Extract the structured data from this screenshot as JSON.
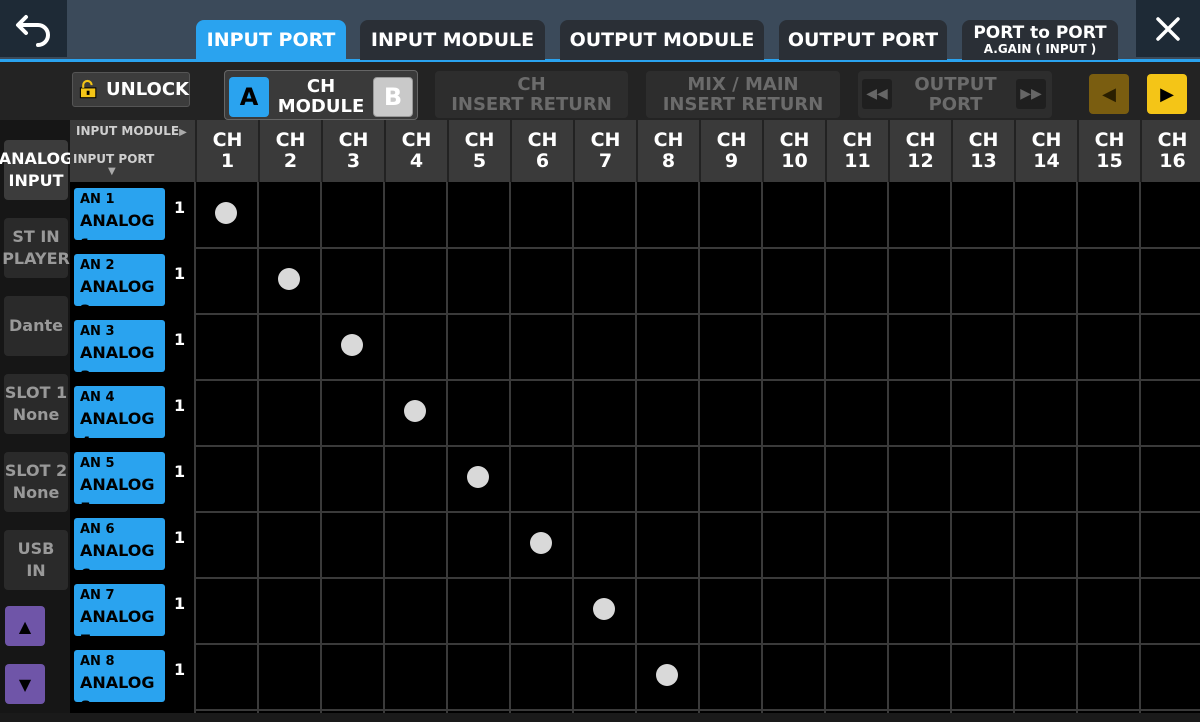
{
  "tabs": [
    {
      "label": "INPUT PORT",
      "active": true
    },
    {
      "label": "INPUT MODULE",
      "active": false
    },
    {
      "label": "OUTPUT MODULE",
      "active": false
    },
    {
      "label": "OUTPUT PORT",
      "active": false
    },
    {
      "label": "PORT to PORT",
      "sublabel": "A.GAIN ( INPUT )",
      "active": false
    }
  ],
  "toolbar": {
    "unlock_label": "UNLOCK",
    "ch_module": {
      "a": "A",
      "label_line1": "CH",
      "label_line2": "MODULE",
      "b": "B"
    },
    "ch_insert_return": {
      "line1": "CH",
      "line2": "INSERT RETURN"
    },
    "mix_main_insert_return": {
      "line1": "MIX / MAIN",
      "line2": "INSERT RETURN"
    },
    "output_port": {
      "line1": "OUTPUT",
      "line2": "PORT"
    }
  },
  "categories": [
    {
      "line1": "ANALOG",
      "line2": "INPUT",
      "active": true
    },
    {
      "line1": "ST IN",
      "line2": "PLAYER",
      "active": false
    },
    {
      "line1": "Dante",
      "line2": "",
      "active": false
    },
    {
      "line1": "SLOT 1",
      "line2": "None",
      "active": false
    },
    {
      "line1": "SLOT 2",
      "line2": "None",
      "active": false
    },
    {
      "line1": "USB",
      "line2": "IN",
      "active": false
    }
  ],
  "grid_header": {
    "input_module_label": "INPUT MODULE",
    "input_port_label": "INPUT PORT"
  },
  "columns": [
    {
      "top": "CH",
      "num": "1"
    },
    {
      "top": "CH",
      "num": "2"
    },
    {
      "top": "CH",
      "num": "3"
    },
    {
      "top": "CH",
      "num": "4"
    },
    {
      "top": "CH",
      "num": "5"
    },
    {
      "top": "CH",
      "num": "6"
    },
    {
      "top": "CH",
      "num": "7"
    },
    {
      "top": "CH",
      "num": "8"
    },
    {
      "top": "CH",
      "num": "9"
    },
    {
      "top": "CH",
      "num": "10"
    },
    {
      "top": "CH",
      "num": "11"
    },
    {
      "top": "CH",
      "num": "12"
    },
    {
      "top": "CH",
      "num": "13"
    },
    {
      "top": "CH",
      "num": "14"
    },
    {
      "top": "CH",
      "num": "15"
    },
    {
      "top": "CH",
      "num": "16"
    }
  ],
  "rows": [
    {
      "short": "AN 1",
      "name": "ANALOG 1",
      "count": "1",
      "patched_col": 1
    },
    {
      "short": "AN 2",
      "name": "ANALOG 2",
      "count": "1",
      "patched_col": 2
    },
    {
      "short": "AN 3",
      "name": "ANALOG 3",
      "count": "1",
      "patched_col": 3
    },
    {
      "short": "AN 4",
      "name": "ANALOG 4",
      "count": "1",
      "patched_col": 4
    },
    {
      "short": "AN 5",
      "name": "ANALOG 5",
      "count": "1",
      "patched_col": 5
    },
    {
      "short": "AN 6",
      "name": "ANALOG 6",
      "count": "1",
      "patched_col": 6
    },
    {
      "short": "AN 7",
      "name": "ANALOG 7",
      "count": "1",
      "patched_col": 7
    },
    {
      "short": "AN 8",
      "name": "ANALOG 8",
      "count": "1",
      "patched_col": 8
    }
  ],
  "colors": {
    "accent_blue": "#2aa3ef",
    "page_right_yellow": "#f4c517",
    "page_left_dim": "#7a5d10",
    "scroll_purple": "#6f55a8",
    "patch_dot": "#d9d9d9"
  },
  "icons": {
    "back": "back-arrow-icon",
    "close": "close-icon",
    "lock": "unlocked-padlock-icon"
  }
}
